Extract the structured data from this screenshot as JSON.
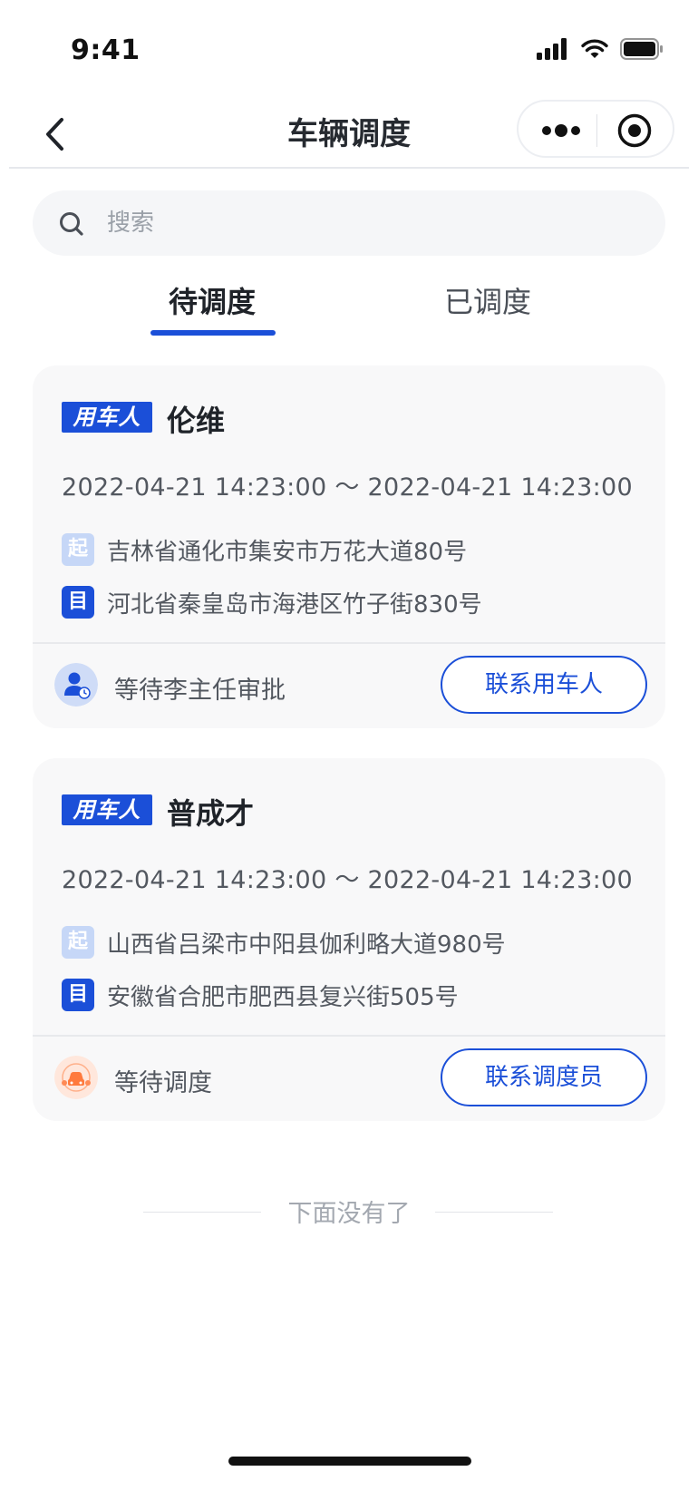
{
  "status_bar": {
    "time": "9:41"
  },
  "nav": {
    "title": "车辆调度"
  },
  "search": {
    "placeholder": "搜索"
  },
  "tabs": [
    {
      "label": "待调度",
      "active": true
    },
    {
      "label": "已调度",
      "active": false
    }
  ],
  "cards": [
    {
      "badge": "用车人",
      "name": "伦维",
      "time_range": "2022-04-21 14:23:00 ～ 2022-04-21 14:23:00",
      "start_tag": "起",
      "start_address": "吉林省通化市集安市万花大道80号",
      "end_tag": "目",
      "end_address": "河北省秦皇岛市海港区竹子街830号",
      "status": "等待李主任审批",
      "status_icon": "approver-avatar-icon",
      "action": "联系用车人"
    },
    {
      "badge": "用车人",
      "name": "普成才",
      "time_range": "2022-04-21 14:23:00 ～ 2022-04-21 14:23:00",
      "start_tag": "起",
      "start_address": "山西省吕梁市中阳县伽利略大道980号",
      "end_tag": "目",
      "end_address": "安徽省合肥市肥西县复兴街505号",
      "status": "等待调度",
      "status_icon": "car-dispatch-icon",
      "action": "联系调度员"
    }
  ],
  "footer": {
    "end_text": "下面没有了"
  },
  "colors": {
    "accent": "#1b4fd8",
    "card_bg": "#f8f8f9",
    "light_tag": "#c6d7f7",
    "orange": "#ff7a3d"
  }
}
